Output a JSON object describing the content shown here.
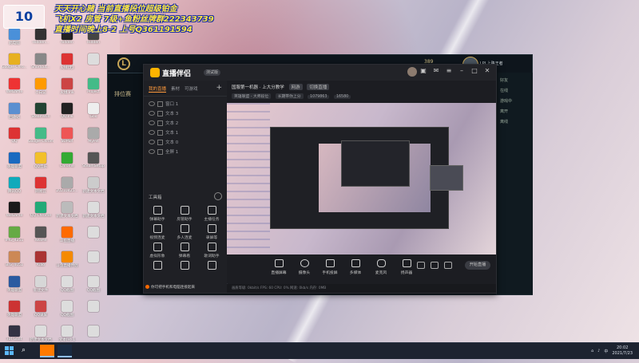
{
  "overlay": {
    "logo": "10",
    "line1": "天天开心赌  当前直播段位超级铂金",
    "line2": "飞机X2  房管 7级+鱼粉丝牌群222343739",
    "line3": "直播时间晚上8-2  上号Q361191594"
  },
  "desktop_icons": [
    {
      "label": "此电脑",
      "color": "#4a90d9"
    },
    {
      "label": "Hidden...",
      "color": "#333"
    },
    {
      "label": "hidden",
      "color": "#222"
    },
    {
      "label": "Hidden",
      "color": "#444"
    },
    {
      "label": "Google Chro...",
      "color": "#e7b020"
    },
    {
      "label": "Shortcut...",
      "color": "#888"
    },
    {
      "label": "火绒(无)",
      "color": "#d33"
    },
    {
      "label": "",
      "color": "#ddd"
    },
    {
      "label": "WeGame",
      "color": "#e33"
    },
    {
      "label": "小白记",
      "color": "#ff9a00"
    },
    {
      "label": "火绒.lnk",
      "color": "#c44"
    },
    {
      "label": "Project",
      "color": "#4b8"
    },
    {
      "label": "回收站",
      "color": "#5a8fd0"
    },
    {
      "label": "SteamWin",
      "color": "#243"
    },
    {
      "label": "QQ.lnk",
      "color": "#222"
    },
    {
      "label": "Goo",
      "color": "#eee"
    },
    {
      "label": "QQ",
      "color": "#d33"
    },
    {
      "label": "Google Chrome",
      "color": "#4b8"
    },
    {
      "label": "SUPER",
      "color": "#e55"
    },
    {
      "label": "MyPin",
      "color": "#aaa"
    },
    {
      "label": "英雄联盟",
      "color": "#1a6ac0"
    },
    {
      "label": "QQ音乐",
      "color": "#f2c02a"
    },
    {
      "label": "Chrome",
      "color": "#3a3"
    },
    {
      "label": "SteamSetup",
      "color": "#555"
    },
    {
      "label": "腾讯QQ",
      "color": "#1ab"
    },
    {
      "label": "网易云",
      "color": "#d33"
    },
    {
      "label": "20210425...",
      "color": "#aaa"
    },
    {
      "label": "新建文本文档",
      "color": "#ccc"
    },
    {
      "label": "WeGame",
      "color": "#1a1a1a"
    },
    {
      "label": "QQ Chrome",
      "color": "#2a7"
    },
    {
      "label": "新建文本文档",
      "color": "#bbb"
    },
    {
      "label": "新建文本文档",
      "color": "#ddd"
    },
    {
      "label": "IMG_4251",
      "color": "#6a4"
    },
    {
      "label": "ReaMe",
      "color": "#555"
    },
    {
      "label": "斗鱼直播",
      "color": "#ff6a00"
    },
    {
      "label": "",
      "color": "#ddd"
    },
    {
      "label": "BIG_4051",
      "color": "#c85"
    },
    {
      "label": "Kiao",
      "color": "#a33"
    },
    {
      "label": "斗鱼直播伴侣",
      "color": "#f58a00"
    },
    {
      "label": "",
      "color": "#ddd"
    },
    {
      "label": "英雄联盟",
      "color": "#2a5aa0"
    },
    {
      "label": "新建文件",
      "color": "#d7d7d7"
    },
    {
      "label": "QQ截图",
      "color": "#ddd"
    },
    {
      "label": "QQ截图",
      "color": "#ddd"
    },
    {
      "label": "英雄联盟",
      "color": "#c33"
    },
    {
      "label": "QQ录屏",
      "color": "#c44"
    },
    {
      "label": "QQ截图",
      "color": "#ddd"
    },
    {
      "label": "",
      "color": "#ddd"
    },
    {
      "label": "Fat Goat",
      "color": "#334"
    },
    {
      "label": "新建文本文档",
      "color": "#ddd"
    },
    {
      "label": "文本(H) 1",
      "color": "#ddd"
    },
    {
      "label": "",
      "color": "#ddd"
    }
  ],
  "lol": {
    "logo": "L",
    "side_text": "排位赛",
    "coins": "389",
    "name": "LPL上路王者",
    "right_panel": [
      "好友",
      "在线",
      "游戏中",
      "离开",
      "离线"
    ]
  },
  "app": {
    "name": "直播伴侣",
    "version": "测试版",
    "tabs": [
      "我的直播",
      "素材",
      "可游戏"
    ],
    "scenes": [
      "窗口 1",
      "文本 3",
      "文本 2",
      "文本 1",
      "文本 0",
      "全屏 1"
    ],
    "tools_title": "工具箱",
    "tools": [
      "弹幕助手",
      "房管助手",
      "主播任务",
      "视频连麦",
      "多人连麦",
      "录屏等",
      "虚拟形象",
      "弹幕看",
      "歌词助手",
      "",
      "",
      ""
    ],
    "tip": "你可把手机和电脑连接起来",
    "room_title": "国服第一机器 · 上大分教学",
    "room_tag1": "网游",
    "room_tag2": "切换直播",
    "room_chip": "英雄联盟 - 大师段位",
    "room_sub1": "长期带你上分",
    "room_sub2": "1079863",
    "room_sub3": "16580",
    "controls": [
      "直播屏幕",
      "摄像头",
      "手机投屏",
      "多媒体",
      "麦克风",
      "扬声器"
    ],
    "start_button": "开始直播",
    "status_text": "画质等级: 0kbit/s   FPS: 60   CPU: 0%   网速: 0kb/s   内存: 0MB"
  },
  "taskbar": {
    "time": "20:02",
    "date": "2021/7/23",
    "lang": "中"
  }
}
